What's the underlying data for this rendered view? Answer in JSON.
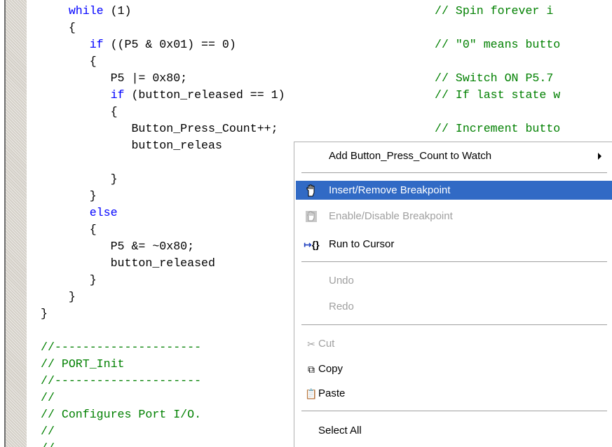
{
  "code": {
    "lines": [
      {
        "indent": "    ",
        "kw": "while",
        "text": " (1)",
        "comment": "// Spin forever i"
      },
      {
        "indent": "    ",
        "kw": "",
        "text": "{",
        "comment": ""
      },
      {
        "indent": "       ",
        "kw": "if",
        "text": " ((P5 & 0x01) == 0)",
        "comment": "// \"0\" means butto"
      },
      {
        "indent": "       ",
        "kw": "",
        "text": "{",
        "comment": ""
      },
      {
        "indent": "          ",
        "kw": "",
        "text": "P5 |= 0x80;",
        "comment": "// Switch ON P5.7"
      },
      {
        "indent": "          ",
        "kw": "if",
        "text": " (button_released == 1)",
        "comment": "// If last state w"
      },
      {
        "indent": "          ",
        "kw": "",
        "text": "{",
        "comment": ""
      },
      {
        "indent": "             ",
        "kw": "",
        "text": "Button_Press_Count++;",
        "comment": "// Increment butto"
      },
      {
        "indent": "             ",
        "kw": "",
        "text": "button_releas",
        "comment": ""
      },
      {
        "indent": "",
        "kw": "",
        "text": "",
        "comment": ""
      },
      {
        "indent": "          ",
        "kw": "",
        "text": "}",
        "comment": ""
      },
      {
        "indent": "       ",
        "kw": "",
        "text": "}",
        "comment": ""
      },
      {
        "indent": "       ",
        "kw": "else",
        "text": "",
        "comment": ""
      },
      {
        "indent": "       ",
        "kw": "",
        "text": "{",
        "comment": ""
      },
      {
        "indent": "          ",
        "kw": "",
        "text": "P5 &= ~0x80;",
        "comment": ""
      },
      {
        "indent": "          ",
        "kw": "",
        "text": "button_released",
        "comment": ""
      },
      {
        "indent": "       ",
        "kw": "",
        "text": "}",
        "comment": ""
      },
      {
        "indent": "    ",
        "kw": "",
        "text": "}",
        "comment": ""
      },
      {
        "indent": "",
        "kw": "",
        "text": "}",
        "comment": ""
      },
      {
        "indent": "",
        "kw": "",
        "text": "",
        "comment": ""
      },
      {
        "indent": "",
        "kw": "",
        "text": "",
        "comment": "//---------------------"
      },
      {
        "indent": "",
        "kw": "",
        "text": "",
        "comment": "// PORT_Init"
      },
      {
        "indent": "",
        "kw": "",
        "text": "",
        "comment": "//---------------------"
      },
      {
        "indent": "",
        "kw": "",
        "text": "",
        "comment": "//"
      },
      {
        "indent": "",
        "kw": "",
        "text": "",
        "comment": "// Configures Port I/O."
      },
      {
        "indent": "",
        "kw": "",
        "text": "",
        "comment": "//"
      },
      {
        "indent": "",
        "kw": "",
        "text": "",
        "comment": "//"
      }
    ]
  },
  "context_menu": {
    "add_watch": "Add Button_Press_Count to Watch",
    "insert_remove_breakpoint": "Insert/Remove Breakpoint",
    "enable_disable_breakpoint": "Enable/Disable Breakpoint",
    "run_to_cursor": "Run to Cursor",
    "undo": "Undo",
    "redo": "Redo",
    "cut": "Cut",
    "copy": "Copy",
    "paste": "Paste",
    "select_all": "Select All"
  },
  "colors": {
    "keyword": "#0000ff",
    "comment": "#008000",
    "highlight": "#316ac5"
  },
  "icons": {
    "breakpoint": "hand-icon",
    "disabled_breakpoint": "hand-disabled-icon",
    "run_to_cursor": "run-to-cursor-icon",
    "cut": "scissors-icon",
    "copy": "copy-icon",
    "paste": "paste-icon",
    "submenu": "submenu-arrow-icon"
  }
}
